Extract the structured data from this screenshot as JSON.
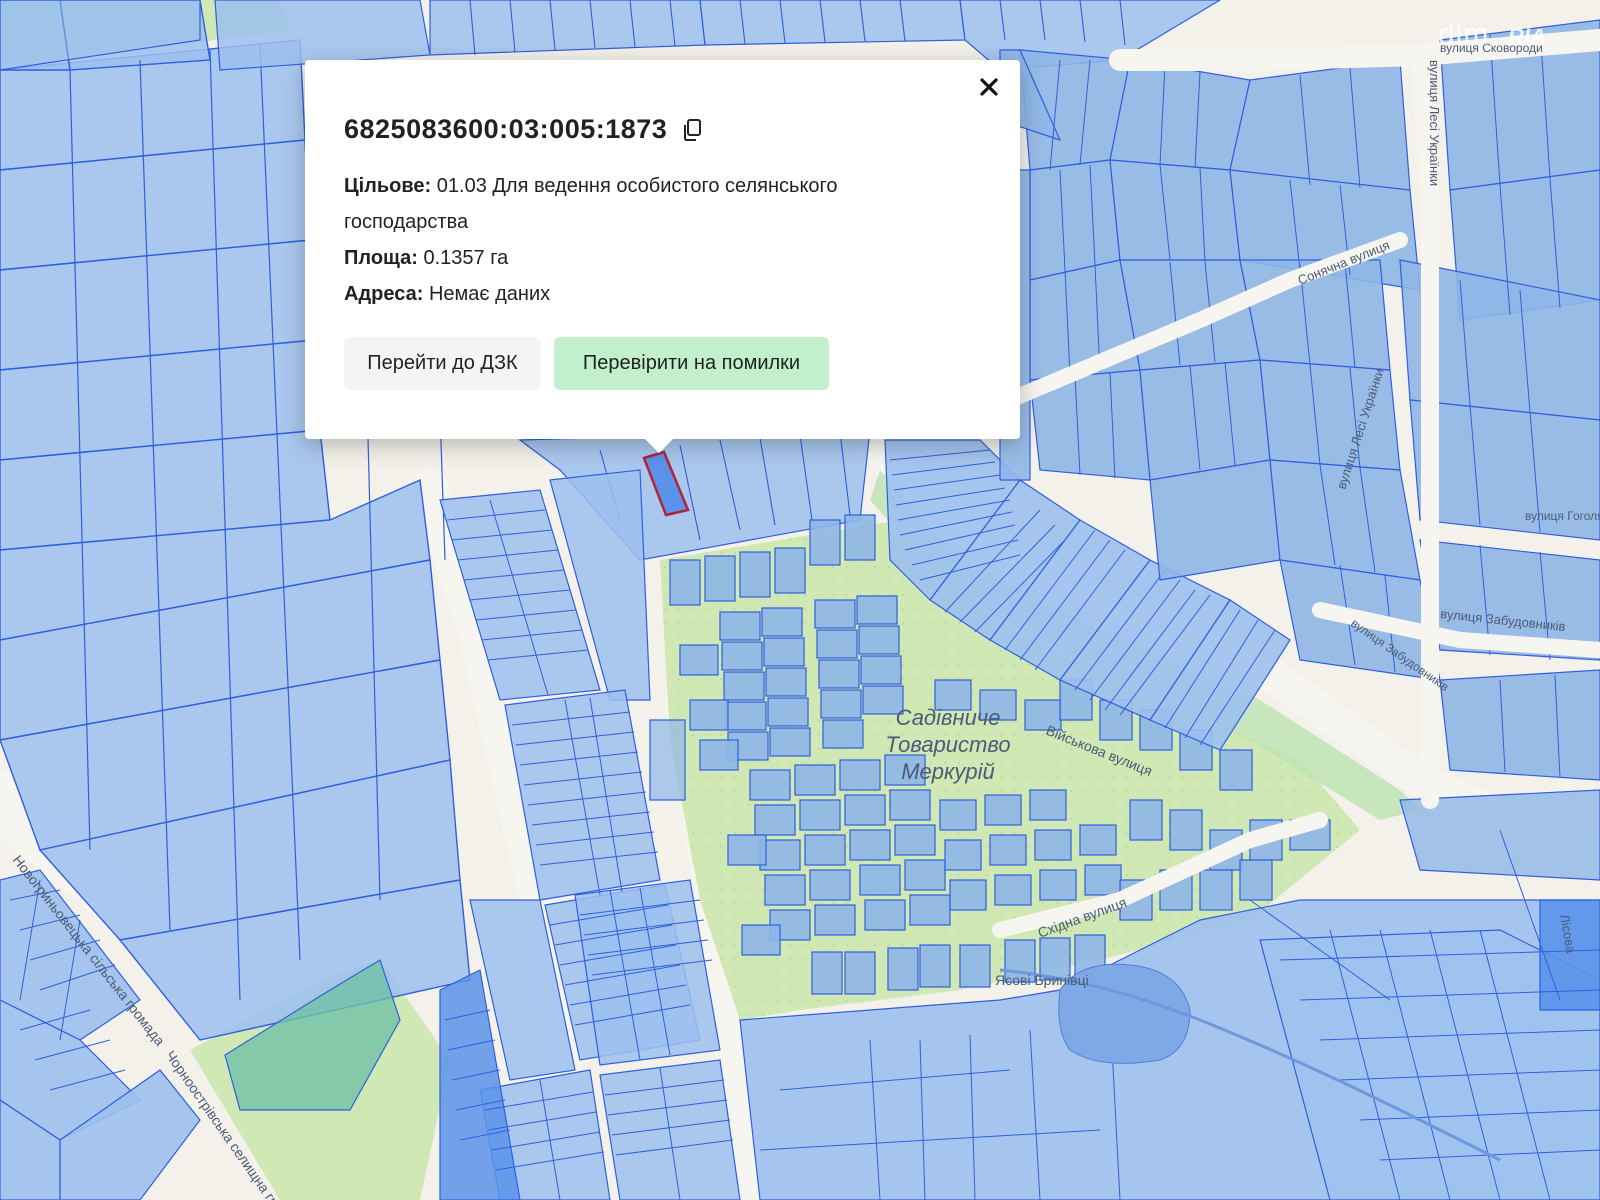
{
  "popup": {
    "parcel_id": "6825083600:03:005:1873",
    "purpose_label": "Цільове:",
    "purpose_value": "01.03 Для ведення особистого селянського господарства",
    "area_label": "Площа:",
    "area_value": "0.1357 га",
    "address_label": "Адреса:",
    "address_value": "Немає даних",
    "button_dzk": "Перейти до ДЗК",
    "button_check": "Перевірити на помилки",
    "close_icon": "close-icon",
    "copy_icon": "copy-icon"
  },
  "map": {
    "labels": {
      "garden_society_1": "Садівниче",
      "garden_society_2": "Товариство",
      "garden_society_3": "Меркурій",
      "street_military": "Військова вулиця",
      "street_east": "Східна вулиця",
      "street_ash": "Ясові Бринівці",
      "street_solar": "Сонячна вулиця",
      "street_lesi_1": "вулиця Лесі Українки",
      "street_lesi_2": "вулиця Лесі Українки",
      "street_builders": "вулиця Забудовників",
      "street_builders_2": "вулиця Забудовників",
      "street_top_right": "вулиця Сковороди",
      "community_1": "Новогриньовецька сільська громада",
      "community_2": "Чорноострівська селищна громада",
      "street_right_edge": "вулиця Гоголя",
      "street_bottom_right": "Лісова"
    },
    "colors": {
      "parcel_fill": "#9cc0ee",
      "parcel_stroke": "#2f5fe0",
      "background": "#f3f1ea",
      "green_area": "#cfe8b4",
      "water": "#9ec3e6",
      "selected_stroke": "#b3223c",
      "selected_fill": "#5b93ea"
    }
  },
  "watermark": {
    "brand_1": "dim",
    "brand_2": "RIA"
  }
}
